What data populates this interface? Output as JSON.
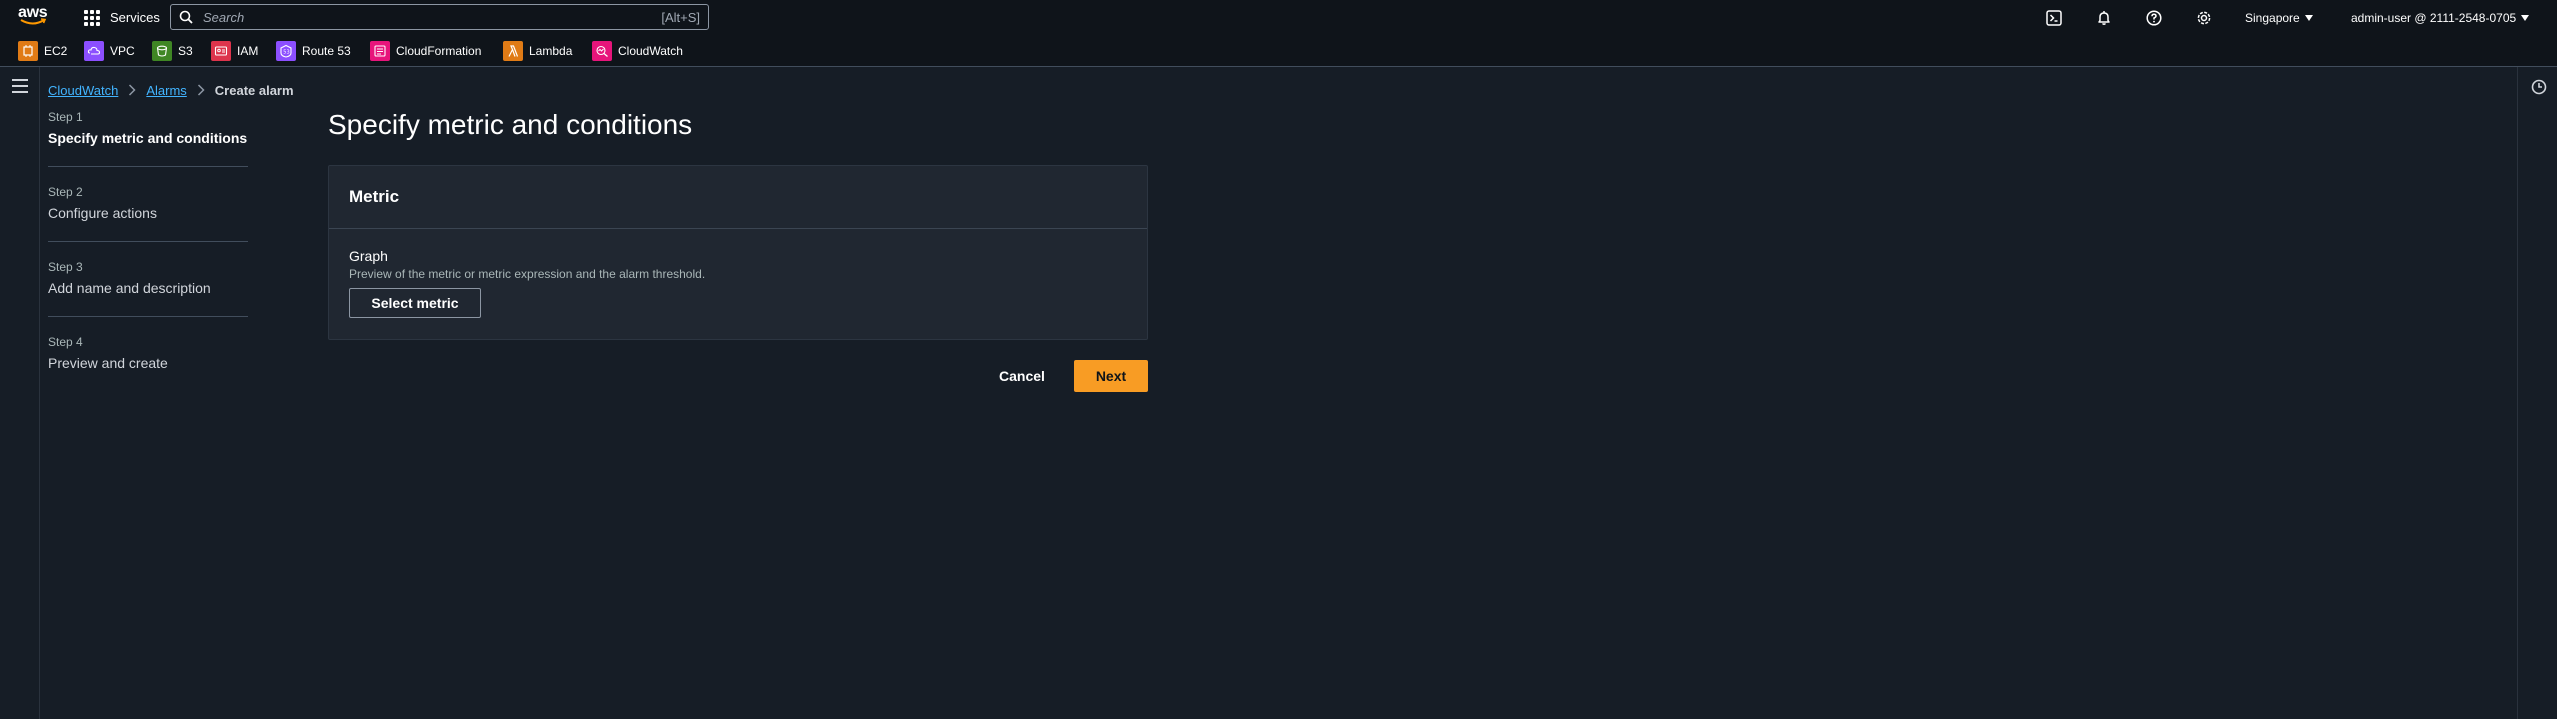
{
  "topnav": {
    "logo": "aws",
    "services_label": "Services",
    "search_placeholder": "Search",
    "search_shortcut": "[Alt+S]",
    "icons": [
      "cloudshell-icon",
      "notifications-icon",
      "help-icon",
      "settings-icon"
    ],
    "region": "Singapore",
    "account": "admin-user @ 2111-2548-0705"
  },
  "favorites": [
    {
      "label": "EC2",
      "icon": "ec2-icon",
      "color": "#e07b16"
    },
    {
      "label": "VPC",
      "icon": "vpc-icon",
      "color": "#8c4fff"
    },
    {
      "label": "S3",
      "icon": "s3-icon",
      "color": "#3f8624"
    },
    {
      "label": "IAM",
      "icon": "iam-icon",
      "color": "#dd344c"
    },
    {
      "label": "Route 53",
      "icon": "route53-icon",
      "color": "#8c4fff"
    },
    {
      "label": "CloudFormation",
      "icon": "cloudformation-icon",
      "color": "#e7157b"
    },
    {
      "label": "Lambda",
      "icon": "lambda-icon",
      "color": "#e07b16"
    },
    {
      "label": "CloudWatch",
      "icon": "cloudwatch-icon",
      "color": "#e7157b"
    }
  ],
  "breadcrumb": {
    "items": [
      "CloudWatch",
      "Alarms"
    ],
    "current": "Create alarm"
  },
  "steps": [
    {
      "number": "Step 1",
      "label": "Specify metric and conditions",
      "active": true
    },
    {
      "number": "Step 2",
      "label": "Configure actions",
      "active": false
    },
    {
      "number": "Step 3",
      "label": "Add name and description",
      "active": false
    },
    {
      "number": "Step 4",
      "label": "Preview and create",
      "active": false
    }
  ],
  "main": {
    "title": "Specify metric and conditions",
    "panel": {
      "title": "Metric",
      "field_label": "Graph",
      "field_desc": "Preview of the metric or metric expression and the alarm threshold.",
      "select_button": "Select metric"
    },
    "cancel_label": "Cancel",
    "next_label": "Next"
  },
  "colors": {
    "accent": "#f89c24",
    "link": "#42b4ff",
    "background": "#161d26",
    "topbar": "#0f141a"
  }
}
